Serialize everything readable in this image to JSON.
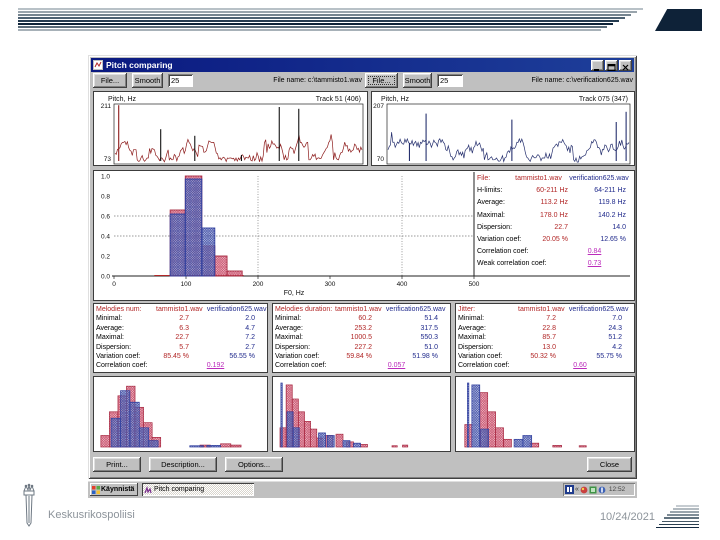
{
  "slide": {
    "footer_left": "Keskusrikospoliisi",
    "footer_right": "10/24/2021"
  },
  "decor": {
    "header_line_colors": [
      "#b8c1c7",
      "#99a4ac",
      "#75848f",
      "#4d6172",
      "#253b50",
      "#0f2439",
      "#5a6b79",
      "#a7b1b8"
    ],
    "footer_line_colors": [
      "#c6ccd1",
      "#b2bac0",
      "#9aa5ad",
      "#7f8d97",
      "#62737f",
      "#455866",
      "#293e4f",
      "#122940"
    ],
    "corner_color": "#0e2238"
  },
  "window": {
    "title": "Pitch comparing",
    "toolbar": {
      "left": {
        "file_button": "File...",
        "smooth_button": "Smooth",
        "smooth_value": "25",
        "file_label": "File name: c:\\tammisto1.wav"
      },
      "right": {
        "file_button": "File...",
        "smooth_button": "Smooth",
        "smooth_value": "25",
        "file_label": "File name: c:\\verification625.wav"
      }
    },
    "bottom_buttons": {
      "print": "Print...",
      "description": "Description...",
      "options": "Options...",
      "close": "Close"
    }
  },
  "taskbar": {
    "start": "Käynnistä",
    "task": "Pitch comparing",
    "tray_time": "12:52"
  },
  "stats_main": {
    "rows": [
      {
        "t": "h",
        "l": "File:",
        "v1": "tammisto1.wav",
        "v2": "verification625.wav"
      },
      {
        "t": "n",
        "l": "H-limits:",
        "v1": "60-211 Hz",
        "v2": "64-211 Hz"
      },
      {
        "t": "n",
        "l": "Average:",
        "v1": "113.2 Hz",
        "v2": "119.8 Hz"
      },
      {
        "t": "n",
        "l": "Maximal:",
        "v1": "178.0 Hz",
        "v2": "140.2 Hz"
      },
      {
        "t": "n",
        "l": "Dispersion:",
        "v1": "22.7",
        "v2": "14.0"
      },
      {
        "t": "n",
        "l": "Variation coef:",
        "v1": "20.05 %",
        "v2": "12.65 %"
      },
      {
        "t": "c",
        "l": "Correlation coef:",
        "v": "0.84"
      },
      {
        "t": "c",
        "l": "Weak correlation coef:",
        "v": "0.73"
      }
    ]
  },
  "stats_panels": [
    {
      "header": "Melodies num:",
      "f1": "tammisto1.wav",
      "f2": "verification625.wav",
      "rows": [
        [
          "Minimal:",
          "2.7",
          "2.0"
        ],
        [
          "Average:",
          "6.3",
          "4.7"
        ],
        [
          "Maximal:",
          "22.7",
          "7.2"
        ],
        [
          "Dispersion:",
          "5.7",
          "2.7"
        ],
        [
          "Variation coef:",
          "85.45 %",
          "56.55 %"
        ]
      ],
      "corr_label": "Correlation coef:",
      "corr": "0.192"
    },
    {
      "header": "Melodies duration:",
      "f1": "tammisto1.wav",
      "f2": "verification625.wav",
      "rows": [
        [
          "Minimal:",
          "60.2",
          "51.4"
        ],
        [
          "Average:",
          "253.2",
          "317.5"
        ],
        [
          "Maximal:",
          "1000.5",
          "550.3"
        ],
        [
          "Dispersion:",
          "227.2",
          "51.0"
        ],
        [
          "Variation coef:",
          "59.84 %",
          "51.98 %"
        ]
      ],
      "corr_label": "Correlation coef:",
      "corr": "0.057"
    },
    {
      "header": "Jitter:",
      "f1": "tammisto1.wav",
      "f2": "verification625.wav",
      "rows": [
        [
          "Minimal:",
          "7.2",
          "7.0"
        ],
        [
          "Average:",
          "22.8",
          "24.3"
        ],
        [
          "Maximal:",
          "85.7",
          "51.2"
        ],
        [
          "Dispersion:",
          "13.0",
          "4.2"
        ],
        [
          "Variation coef:",
          "50.32 %",
          "55.75 %"
        ]
      ],
      "corr_label": "Correlation coef:",
      "corr": "0.60"
    }
  ],
  "chart_data": [
    {
      "id": "waveform_left",
      "type": "line",
      "ylabel_top": "211",
      "ylabel_bottom": "73",
      "title": "Pitch, Hz",
      "track": "Track 51 (406)",
      "color": "#8c1a1a",
      "seed": 11,
      "spikes": [
        {
          "x": 0.015,
          "t": 0.02,
          "c": "#8c1a1a"
        },
        {
          "x": 0.185,
          "t": 0.42,
          "c": "#111111"
        },
        {
          "x": 0.323,
          "t": 0.53,
          "c": "#111111"
        },
        {
          "x": 0.512,
          "t": 0.85,
          "c": "#111111"
        },
        {
          "x": 0.665,
          "t": 0.05,
          "c": "#111111"
        },
        {
          "x": 0.744,
          "t": 0.08,
          "c": "#111111"
        }
      ]
    },
    {
      "id": "waveform_right",
      "type": "line",
      "ylabel_top": "207",
      "ylabel_bottom": "70",
      "title": "Pitch, Hz",
      "track": "Track 075 (347)",
      "color": "#26306e",
      "seed": 29,
      "spikes": [
        {
          "x": 0.089,
          "t": 0.65,
          "c": "#26306e"
        },
        {
          "x": 0.158,
          "t": 0.16,
          "c": "#26306e"
        },
        {
          "x": 0.514,
          "t": 0.26,
          "c": "#26306e"
        },
        {
          "x": 0.947,
          "t": 0.3,
          "c": "#26306e"
        },
        {
          "x": 0.988,
          "t": 0.13,
          "c": "#26306e"
        }
      ]
    },
    {
      "id": "histogram_main",
      "type": "bar",
      "xlabel": "F0, Hz",
      "xticks": [
        "0",
        "100",
        "200",
        "300",
        "400",
        "500"
      ],
      "yticks": [
        "1.0",
        "0.8",
        "0.6",
        "0.4",
        "0.2",
        "0.0"
      ],
      "xlim": [
        0,
        500
      ],
      "ylim": [
        0,
        1
      ],
      "series": [
        {
          "name": "tammisto1.wav",
          "color": "red",
          "bins": [
            {
              "x0": 78,
              "x1": 99,
              "v": 0.66
            },
            {
              "x0": 99,
              "x1": 122,
              "v": 1.0
            },
            {
              "x0": 122,
              "x1": 140,
              "v": 0.3
            },
            {
              "x0": 140,
              "x1": 157,
              "v": 0.2
            },
            {
              "x0": 157,
              "x1": 178,
              "v": 0.05
            }
          ]
        },
        {
          "name": "verification625.wav",
          "color": "blue",
          "bins": [
            {
              "x0": 78,
              "x1": 99,
              "v": 0.62
            },
            {
              "x0": 99,
              "x1": 122,
              "v": 0.97
            },
            {
              "x0": 122,
              "x1": 140,
              "v": 0.48
            }
          ]
        }
      ],
      "baseline_x": [
        56,
        180
      ]
    },
    {
      "id": "hist_melodies_num",
      "type": "bar",
      "series": [
        {
          "color": "red",
          "bars": [
            [
              0.04,
              0.05,
              0.18
            ],
            [
              0.09,
              0.05,
              0.55
            ],
            [
              0.14,
              0.05,
              0.8
            ],
            [
              0.19,
              0.05,
              0.95
            ],
            [
              0.24,
              0.05,
              0.62
            ],
            [
              0.29,
              0.05,
              0.38
            ],
            [
              0.34,
              0.05,
              0.15
            ],
            [
              0.62,
              0.06,
              0.03
            ],
            [
              0.74,
              0.06,
              0.05
            ],
            [
              0.8,
              0.06,
              0.03
            ]
          ]
        },
        {
          "color": "blue",
          "bars": [
            [
              0.1,
              0.055,
              0.45
            ],
            [
              0.155,
              0.055,
              0.88
            ],
            [
              0.21,
              0.055,
              0.7
            ],
            [
              0.265,
              0.055,
              0.3
            ],
            [
              0.32,
              0.055,
              0.1
            ],
            [
              0.56,
              0.08,
              0.02
            ],
            [
              0.66,
              0.08,
              0.025
            ]
          ]
        }
      ]
    },
    {
      "id": "hist_melodies_duration",
      "type": "bar",
      "series": [
        {
          "color": "red",
          "bars": [
            [
              0.04,
              0.035,
              0.3
            ],
            [
              0.075,
              0.035,
              0.97
            ],
            [
              0.11,
              0.035,
              0.75
            ],
            [
              0.145,
              0.035,
              0.55
            ],
            [
              0.18,
              0.035,
              0.4
            ],
            [
              0.215,
              0.035,
              0.28
            ],
            [
              0.25,
              0.035,
              0.14
            ],
            [
              0.3,
              0.04,
              0.18
            ],
            [
              0.36,
              0.04,
              0.2
            ],
            [
              0.42,
              0.04,
              0.08
            ],
            [
              0.5,
              0.04,
              0.04
            ],
            [
              0.68,
              0.03,
              0.02
            ],
            [
              0.74,
              0.03,
              0.03
            ]
          ]
        },
        {
          "color": "blue",
          "bars": [
            [
              0.045,
              0.008,
              1.0
            ],
            [
              0.08,
              0.035,
              0.55
            ],
            [
              0.115,
              0.035,
              0.3
            ],
            [
              0.26,
              0.04,
              0.22
            ],
            [
              0.31,
              0.04,
              0.18
            ],
            [
              0.4,
              0.04,
              0.1
            ],
            [
              0.46,
              0.04,
              0.06
            ]
          ]
        }
      ]
    },
    {
      "id": "hist_jitter",
      "type": "bar",
      "series": [
        {
          "color": "red",
          "bars": [
            [
              0.05,
              0.04,
              0.35
            ],
            [
              0.135,
              0.045,
              0.85
            ],
            [
              0.18,
              0.045,
              0.55
            ],
            [
              0.225,
              0.045,
              0.3
            ],
            [
              0.27,
              0.045,
              0.12
            ],
            [
              0.42,
              0.05,
              0.06
            ],
            [
              0.55,
              0.05,
              0.025
            ],
            [
              0.7,
              0.04,
              0.02
            ]
          ]
        },
        {
          "color": "blue",
          "bars": [
            [
              0.065,
              0.008,
              1.0
            ],
            [
              0.09,
              0.045,
              0.97
            ],
            [
              0.14,
              0.045,
              0.28
            ],
            [
              0.33,
              0.05,
              0.12
            ],
            [
              0.38,
              0.05,
              0.18
            ]
          ]
        }
      ]
    }
  ]
}
